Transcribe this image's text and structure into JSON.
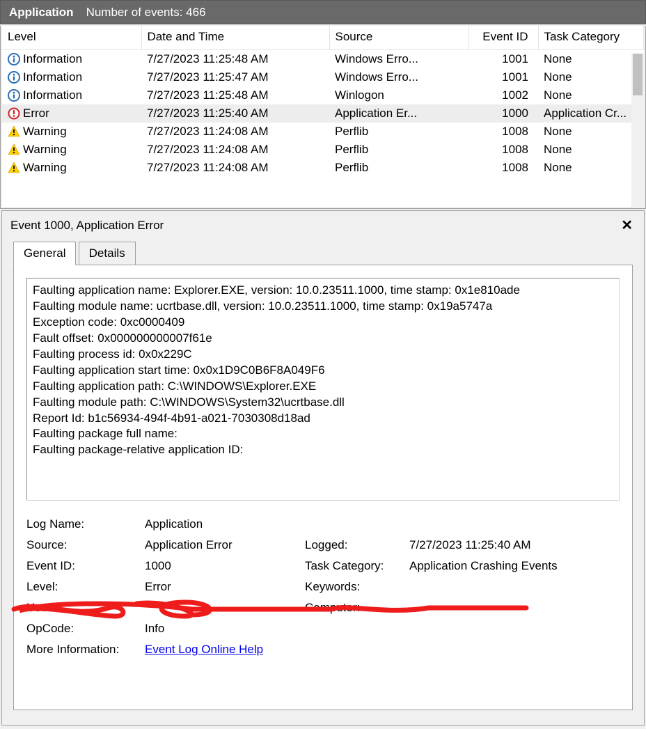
{
  "header": {
    "title": "Application",
    "count_label": "Number of events: 466"
  },
  "columns": {
    "level": "Level",
    "date": "Date and Time",
    "source": "Source",
    "eventid": "Event ID",
    "task": "Task Category"
  },
  "rows": [
    {
      "icon": "info",
      "level": "Information",
      "date": "7/27/2023 11:25:48 AM",
      "source": "Windows Erro...",
      "eid": "1001",
      "task": "None"
    },
    {
      "icon": "info",
      "level": "Information",
      "date": "7/27/2023 11:25:47 AM",
      "source": "Windows Erro...",
      "eid": "1001",
      "task": "None"
    },
    {
      "icon": "info",
      "level": "Information",
      "date": "7/27/2023 11:25:48 AM",
      "source": "Winlogon",
      "eid": "1002",
      "task": "None"
    },
    {
      "icon": "error",
      "level": "Error",
      "date": "7/27/2023 11:25:40 AM",
      "source": "Application Er...",
      "eid": "1000",
      "task": "Application Cr...",
      "selected": true
    },
    {
      "icon": "warn",
      "level": "Warning",
      "date": "7/27/2023 11:24:08 AM",
      "source": "Perflib",
      "eid": "1008",
      "task": "None"
    },
    {
      "icon": "warn",
      "level": "Warning",
      "date": "7/27/2023 11:24:08 AM",
      "source": "Perflib",
      "eid": "1008",
      "task": "None"
    },
    {
      "icon": "warn",
      "level": "Warning",
      "date": "7/27/2023 11:24:08 AM",
      "source": "Perflib",
      "eid": "1008",
      "task": "None"
    }
  ],
  "detail": {
    "title": "Event 1000, Application Error",
    "tabs": {
      "general": "General",
      "details": "Details"
    },
    "description_lines": [
      "Faulting application name: Explorer.EXE, version: 10.0.23511.1000, time stamp: 0x1e810ade",
      "Faulting module name: ucrtbase.dll, version: 10.0.23511.1000, time stamp: 0x19a5747a",
      "Exception code: 0xc0000409",
      "Fault offset: 0x000000000007f61e",
      "Faulting process id: 0x0x229C",
      "Faulting application start time: 0x0x1D9C0B6F8A049F6",
      "Faulting application path: C:\\WINDOWS\\Explorer.EXE",
      "Faulting module path: C:\\WINDOWS\\System32\\ucrtbase.dll",
      "Report Id: b1c56934-494f-4b91-a021-7030308d18ad",
      "Faulting package full name:",
      "Faulting package-relative application ID:"
    ],
    "labels": {
      "logname": "Log Name:",
      "source": "Source:",
      "eventid": "Event ID:",
      "level": "Level:",
      "user": "User:",
      "opcode": "OpCode:",
      "moreinfo": "More Information:",
      "logged": "Logged:",
      "taskcat": "Task Category:",
      "keywords": "Keywords:",
      "computer": "Computer:"
    },
    "values": {
      "logname": "Application",
      "source": "Application Error",
      "eventid": "1000",
      "level": "Error",
      "user": "",
      "opcode": "Info",
      "moreinfo": "Event Log Online Help",
      "logged": "7/27/2023 11:25:40 AM",
      "taskcat": "Application Crashing Events",
      "keywords": "",
      "computer": ""
    }
  }
}
